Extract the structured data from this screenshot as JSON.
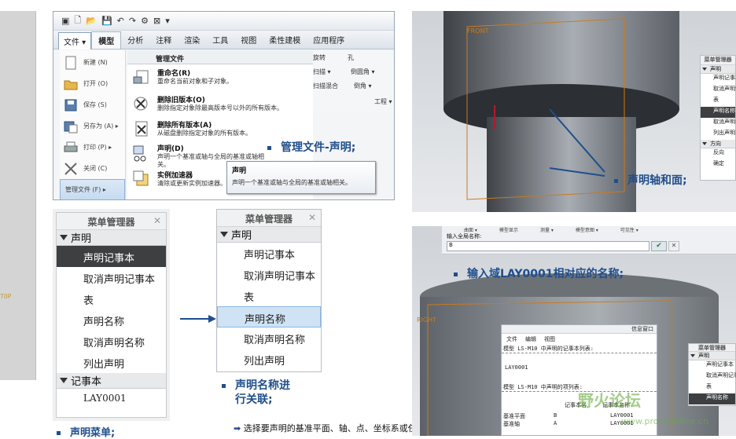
{
  "left_strip": {
    "top_label": "TOP"
  },
  "file_menu": {
    "quick_access_label": "▾",
    "tabs": [
      "文件 ▾",
      "模型",
      "分析",
      "注释",
      "渲染",
      "工具",
      "视图",
      "柔性建模",
      "应用程序"
    ],
    "left_items": [
      {
        "label": "新建 (N)",
        "icon": "new-file-icon"
      },
      {
        "label": "打开 (O)",
        "icon": "open-folder-icon"
      },
      {
        "label": "保存 (S)",
        "icon": "save-icon"
      },
      {
        "label": "另存为 (A)  ▸",
        "icon": "save-as-icon"
      },
      {
        "label": "打印 (P)  ▸",
        "icon": "print-icon"
      },
      {
        "label": "关闭 (C)",
        "icon": "close-icon"
      },
      {
        "label": "管理文件 (F)  ▸",
        "icon": "manage-files-icon"
      }
    ],
    "right_header": "管理文件",
    "right_items": [
      {
        "title": "重命名(R)",
        "desc": "重命名当前对象和子对象。"
      },
      {
        "title": "删除旧版本(O)",
        "desc": "删除指定对象除最高版本号以外的所有版本。"
      },
      {
        "title": "删除所有版本(A)",
        "desc": "从磁盘删除指定对象的所有版本。"
      },
      {
        "title": "声明(D)",
        "desc": "声明一个基准或轴与全局的基准或轴相关。"
      },
      {
        "title": "实例加速器",
        "desc": "清除或更新实例加速器。"
      }
    ],
    "ribbon_right": [
      "旋转",
      "孔",
      "扫描 ▾",
      "倒圆角 ▾",
      "扫描混合",
      "倒角 ▾",
      "工程 ▾"
    ],
    "tooltip": {
      "title": "声明",
      "desc": "声明一个基准或轴与全局的基准或轴相关。"
    }
  },
  "bullets": {
    "manage_declare": "管理文件-声明;",
    "declare_axis_plane": "声明轴和面;",
    "enter_name": "输入域LAY0001相对应的名称;",
    "declare_name_related_line1": "声明名称进",
    "declare_name_related_line2": "行关联;",
    "declare_menu": "声明菜单;"
  },
  "menu_manager_left": {
    "title": "菜单管理器",
    "group1": "声明",
    "items": [
      "声明记事本",
      "取消声明记事本",
      "表",
      "声明名称",
      "取消声明名称",
      "列出声明"
    ],
    "group2": "记事本",
    "notebook_item": "LAY0001"
  },
  "menu_manager_mid": {
    "title": "菜单管理器",
    "group1": "声明",
    "items": [
      "声明记事本",
      "取消声明记事本",
      "表",
      "声明名称",
      "取消声明名称",
      "列出声明"
    ]
  },
  "menu_manager_small": {
    "title": "菜单管理器",
    "group1": "声明",
    "items": [
      "声明记事本",
      "取消声明记事本",
      "表",
      "声明名称",
      "取消声明名称",
      "列出声明"
    ],
    "group2": "方向",
    "dir_items": [
      "反向",
      "确定"
    ]
  },
  "menu_manager_small2": {
    "title": "菜单管理器",
    "group1": "声明",
    "items": [
      "声明记事本",
      "取消声明记事本",
      "表",
      "声明名称"
    ]
  },
  "view_labels": {
    "front": "FRONT",
    "right": "RIGHT"
  },
  "input_panel": {
    "toolbar": [
      "曲面 ▾",
      "模型显示",
      "测量 ▾",
      "模型意图 ▾",
      "可见性 ▾"
    ],
    "prompt": "输入全局名称:",
    "value": "B",
    "confirm": "✔",
    "cancel": "✕"
  },
  "info_window": {
    "title": "信息窗口",
    "menu": [
      "文件",
      "编辑",
      "视图"
    ],
    "line1": "模型 LS-M10 中声明的记事本列表:",
    "line2": "LAY0001",
    "line3": "模型 LS-M10 中声明的项列表:",
    "col1": "记事本名",
    "col2": "记事本名称",
    "rows": [
      {
        "a": "基准平面",
        "b": "B",
        "c": "LAY0001"
      },
      {
        "a": "基准轴",
        "b": "A",
        "c": "LAY0001"
      }
    ]
  },
  "status_line": "选择要声明的基准平面、轴、点、坐标系或任意平面。",
  "watermark": {
    "main": "野火论坛",
    "url": "www.proewildfire.cn"
  }
}
